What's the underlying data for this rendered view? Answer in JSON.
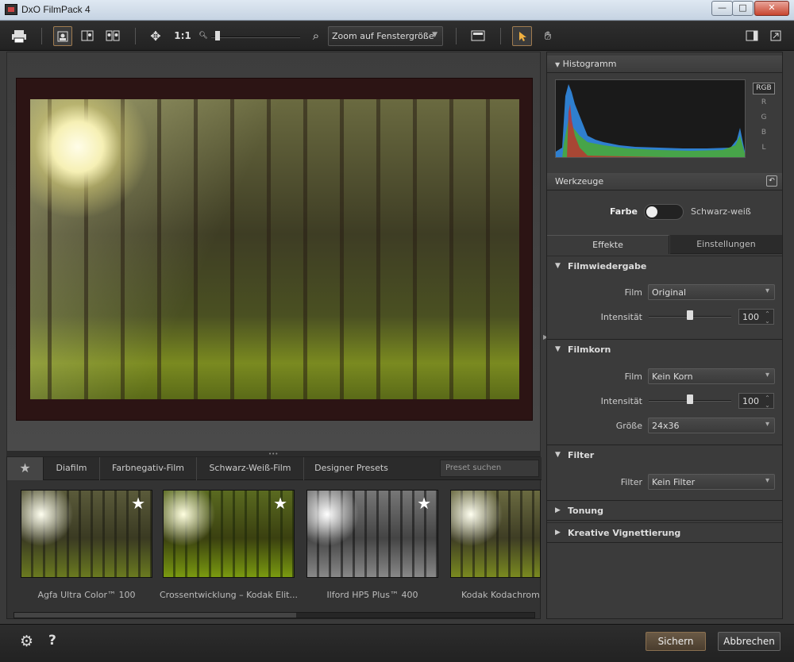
{
  "window": {
    "title": "DxO FilmPack 4",
    "minimize": "—",
    "maximize": "□",
    "close": "✕"
  },
  "toolbar": {
    "print_icon": "print-icon",
    "zoom_ratio": "1:1",
    "zoom_mode": "Zoom auf Fenstergröße",
    "zoom_level": 0.05
  },
  "bottom_tabs": {
    "tabs": [
      "Diafilm",
      "Farbnegativ-Film",
      "Schwarz-Weiß-Film",
      "Designer Presets"
    ],
    "search_placeholder": "Preset suchen"
  },
  "presets": [
    {
      "label": "Agfa Ultra Color™ 100",
      "favorite": true
    },
    {
      "label": "Crossentwicklung – Kodak Elit...",
      "favorite": true
    },
    {
      "label": "Ilford HP5 Plus™ 400",
      "favorite": true
    },
    {
      "label": "Kodak Kodachrom",
      "favorite": false
    }
  ],
  "histogram": {
    "title": "Histogramm",
    "channels": [
      "RGB",
      "R",
      "G",
      "B",
      "L"
    ],
    "selected_channel": "RGB"
  },
  "tools": {
    "title": "Werkzeuge",
    "toggle_left": "Farbe",
    "toggle_right": "Schwarz-weiß",
    "toggle_value": "Farbe",
    "tabs": [
      "Effekte",
      "Einstellungen"
    ],
    "active_tab": "Effekte"
  },
  "sections": {
    "filmwiedergabe": {
      "title": "Filmwiedergabe",
      "film_label": "Film",
      "film_value": "Original",
      "intensity_label": "Intensität",
      "intensity_value": "100"
    },
    "filmkorn": {
      "title": "Filmkorn",
      "film_label": "Film",
      "film_value": "Kein Korn",
      "intensity_label": "Intensität",
      "intensity_value": "100",
      "size_label": "Größe",
      "size_value": "24x36"
    },
    "filter": {
      "title": "Filter",
      "filter_label": "Filter",
      "filter_value": "Kein Filter"
    },
    "tonung": {
      "title": "Tonung"
    },
    "vignette": {
      "title": "Kreative Vignettierung"
    }
  },
  "footer": {
    "save": "Sichern",
    "cancel": "Abbrechen",
    "help": "?"
  }
}
